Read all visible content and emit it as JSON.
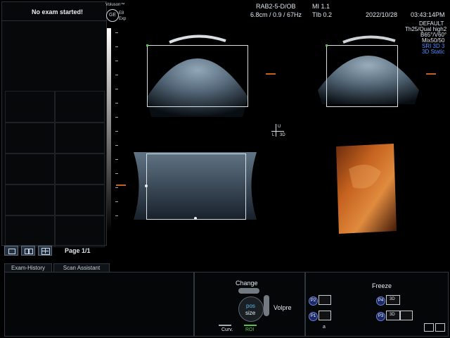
{
  "left_panel": {
    "status": "No exam started!",
    "page_label": "Page 1/1"
  },
  "brand": {
    "logo_text": "GE",
    "sub1": "Voluson™",
    "sub2": "E8",
    "sub3": "Exp"
  },
  "header": {
    "probe": "RAB2-5-D/OB",
    "mi": "MI 1.1",
    "date": "2022/10/28",
    "time": "03:43:14PM",
    "depth": "6.8cm / 0.9 / 67Hz",
    "tib": "TIb 0.2",
    "preset": "DEFAULT",
    "params_line1": "Th25/Qual high2",
    "params_line2": "B65°/V60°",
    "params_line3": "Mix50/50",
    "mode1": "SRI 3D 3",
    "mode2": "3D Static"
  },
  "orientation": {
    "u": "U",
    "l": "L",
    "label": "3D"
  },
  "tabs": {
    "exam_history": "Exam-History",
    "scan_assistant": "Scan Assistant"
  },
  "center_control": {
    "title": "Change",
    "pos": "pos",
    "size": "size",
    "right": "Volpre",
    "left_small": "Curv.",
    "roi": "ROI"
  },
  "right_control": {
    "title": "Freeze",
    "p1": "P1",
    "p2": "P2",
    "p3": "P3",
    "p4": "P4",
    "icon3d_a": "3D",
    "icon3d_b": "3D",
    "small_a": "a"
  },
  "colors": {
    "accent_blue": "#4e8cff",
    "roi_green": "#55c24a",
    "render_orange": "#c5621f",
    "ultrasound_gray": "#7f93a4"
  }
}
